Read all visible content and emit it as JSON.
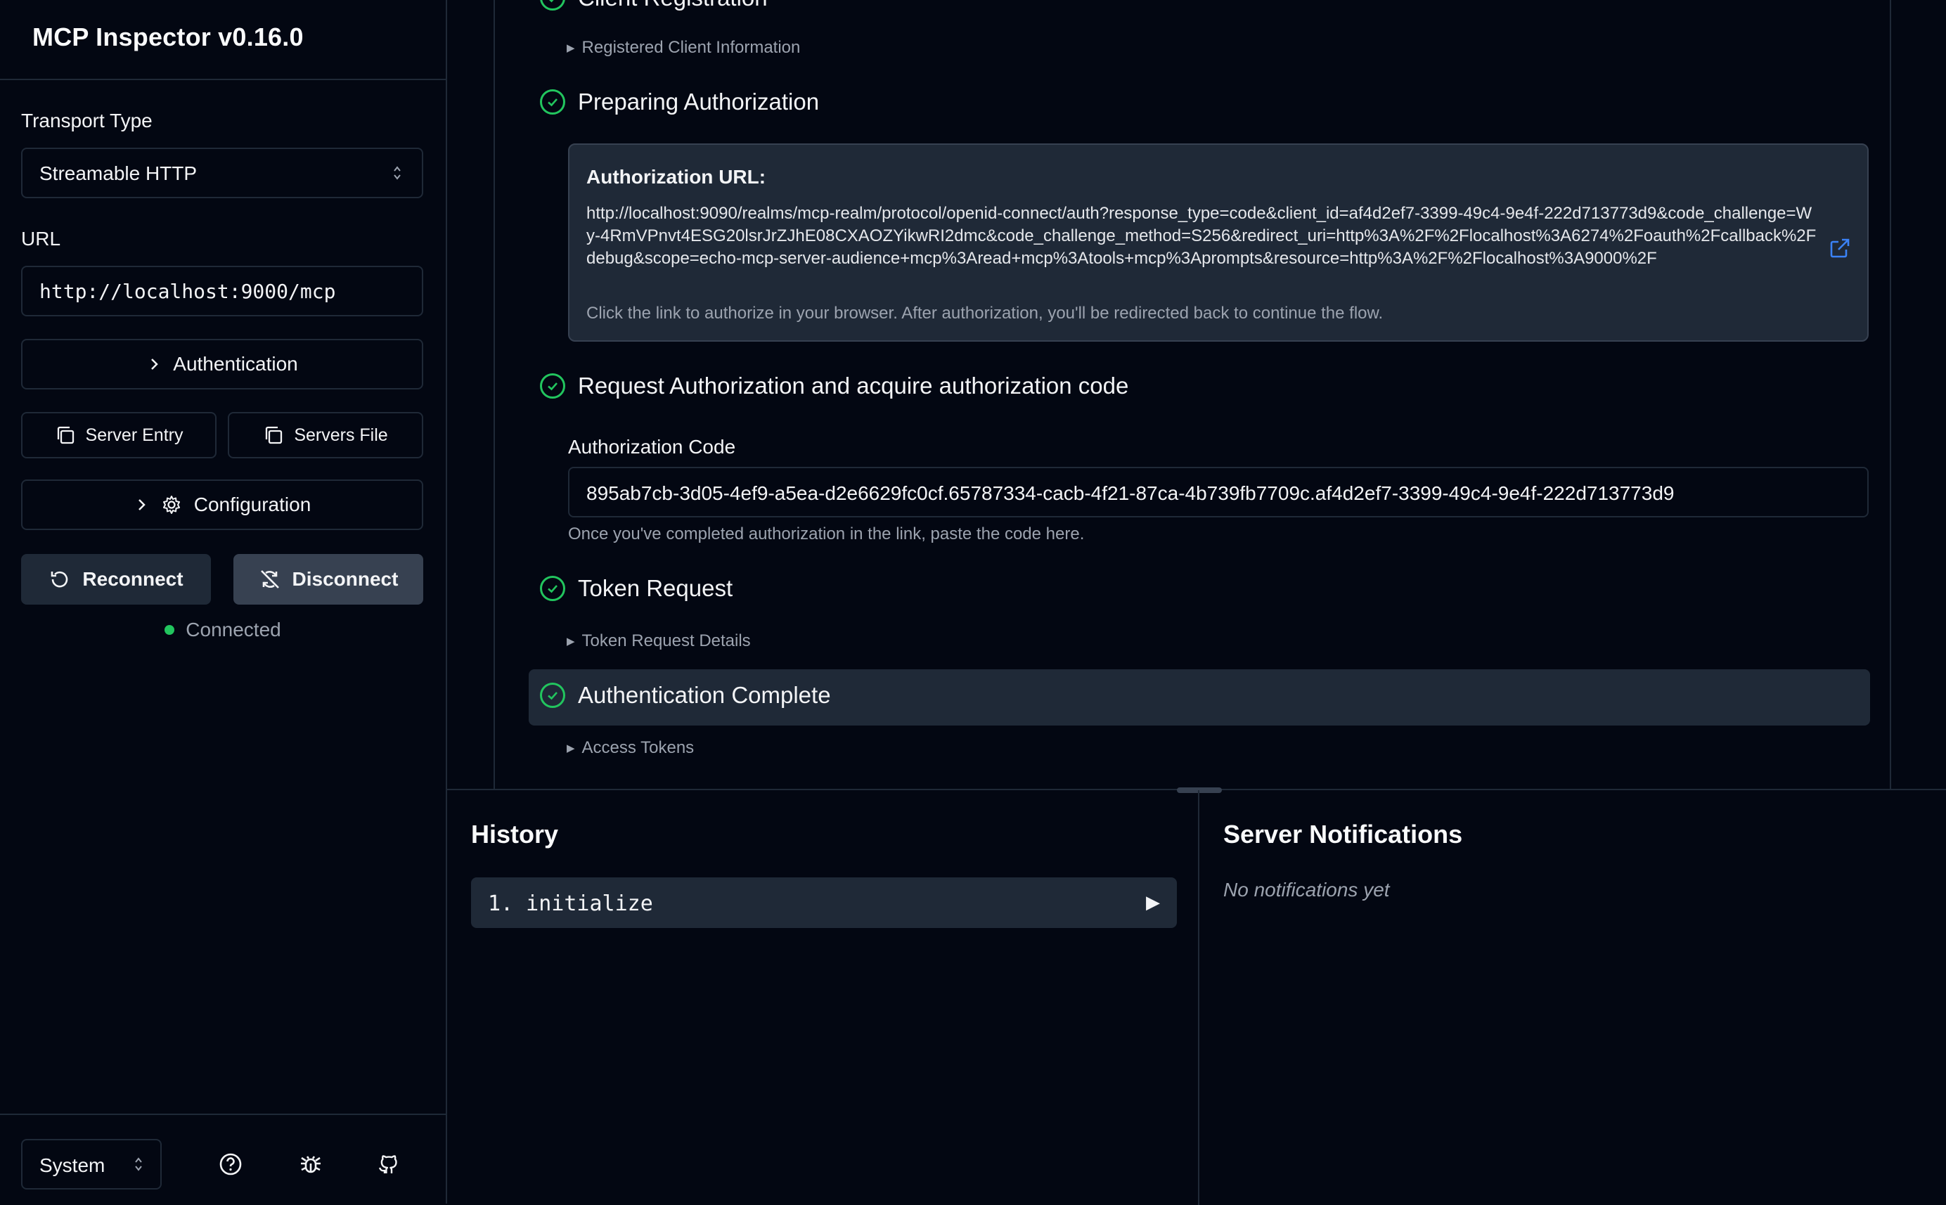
{
  "sidebar": {
    "app_title": "MCP Inspector v0.16.0",
    "transport_label": "Transport Type",
    "transport_value": "Streamable HTTP",
    "url_label": "URL",
    "url_value": "http://localhost:9000/mcp",
    "authentication_label": "Authentication",
    "server_entry_label": "Server Entry",
    "servers_file_label": "Servers File",
    "configuration_label": "Configuration",
    "reconnect_label": "Reconnect",
    "disconnect_label": "Disconnect",
    "status_text": "Connected",
    "status_color": "#22c55e",
    "theme_value": "System",
    "footer_icons": [
      "help-icon",
      "bug-icon",
      "github-icon"
    ]
  },
  "flow": {
    "step_client_registration": "Client Registration",
    "registered_client_info": "Registered Client Information",
    "step_preparing_authorization": "Preparing Authorization",
    "authorization_url_label": "Authorization URL:",
    "authorization_url": "http://localhost:9090/realms/mcp-realm/protocol/openid-connect/auth?response_type=code&client_id=af4d2ef7-3399-49c4-9e4f-222d713773d9&code_challenge=Wy-4RmVPnvt4ESG20lsrJrZJhE08CXAOZYikwRI2dmc&code_challenge_method=S256&redirect_uri=http%3A%2F%2Flocalhost%3A6274%2Foauth%2Fcallback%2Fdebug&scope=echo-mcp-server-audience+mcp%3Aread+mcp%3Atools+mcp%3Aprompts&resource=http%3A%2F%2Flocalhost%3A9000%2F",
    "authorization_url_hint": "Click the link to authorize in your browser. After authorization, you'll be redirected back to continue the flow.",
    "step_request_authorization": "Request Authorization and acquire authorization code",
    "authorization_code_label": "Authorization Code",
    "authorization_code_value": "895ab7cb-3d05-4ef9-a5ea-d2e6629fc0cf.65787334-cacb-4f21-87ca-4b739fb7709c.af4d2ef7-3399-49c4-9e4f-222d713773d9",
    "authorization_code_hint": "Once you've completed authorization in the link, paste the code here.",
    "step_token_request": "Token Request",
    "token_request_details": "Token Request Details",
    "step_authentication_complete": "Authentication Complete",
    "access_tokens": "Access Tokens",
    "success_color": "#22c55e"
  },
  "history": {
    "title": "History",
    "items": [
      {
        "label": "1. initialize"
      }
    ],
    "expand_glyph": "▶"
  },
  "notifications": {
    "title": "Server Notifications",
    "empty_text": "No notifications yet"
  }
}
